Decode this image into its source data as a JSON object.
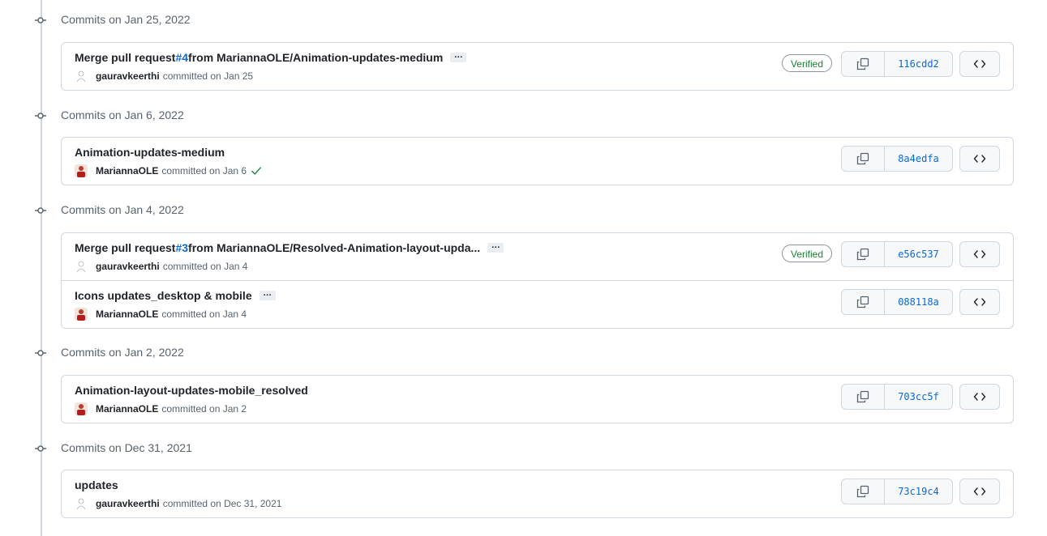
{
  "groups": [
    {
      "title": "Commits on Jan 25, 2022",
      "commits": [
        {
          "pre": "Merge pull request ",
          "pr": "#4",
          "post": " from MariannaOLE/Animation-updates-medium",
          "author": "gauravkeerthi",
          "date": "committed on Jan 25",
          "verified": "Verified",
          "sha": "116cdd2"
        }
      ]
    },
    {
      "title": "Commits on Jan 6, 2022",
      "commits": [
        {
          "title": "Animation-updates-medium",
          "author": "MariannaOLE",
          "date": "committed on Jan 6",
          "sha": "8a4edfa"
        }
      ]
    },
    {
      "title": "Commits on Jan 4, 2022",
      "commits": [
        {
          "pre": "Merge pull request ",
          "pr": "#3",
          "post": " from MariannaOLE/Resolved-Animation-layout-upda...",
          "author": "gauravkeerthi",
          "date": "committed on Jan 4",
          "verified": "Verified",
          "sha": "e56c537"
        },
        {
          "title": "Icons updates_desktop & mobile",
          "author": "MariannaOLE",
          "date": "committed on Jan 4",
          "sha": "088118a"
        }
      ]
    },
    {
      "title": "Commits on Jan 2, 2022",
      "commits": [
        {
          "title": "Animation-layout-updates-mobile_resolved",
          "author": "MariannaOLE",
          "date": "committed on Jan 2",
          "sha": "703cc5f"
        }
      ]
    },
    {
      "title": "Commits on Dec 31, 2021",
      "commits": [
        {
          "title": "updates",
          "author": "gauravkeerthi",
          "date": "committed on Dec 31, 2021",
          "sha": "73c19c4"
        }
      ]
    }
  ],
  "ellipsis_label": "…",
  "colors": {
    "link": "#0969da",
    "verified": "#1a7f37",
    "border": "#d0d7de",
    "muted": "#59636e"
  }
}
